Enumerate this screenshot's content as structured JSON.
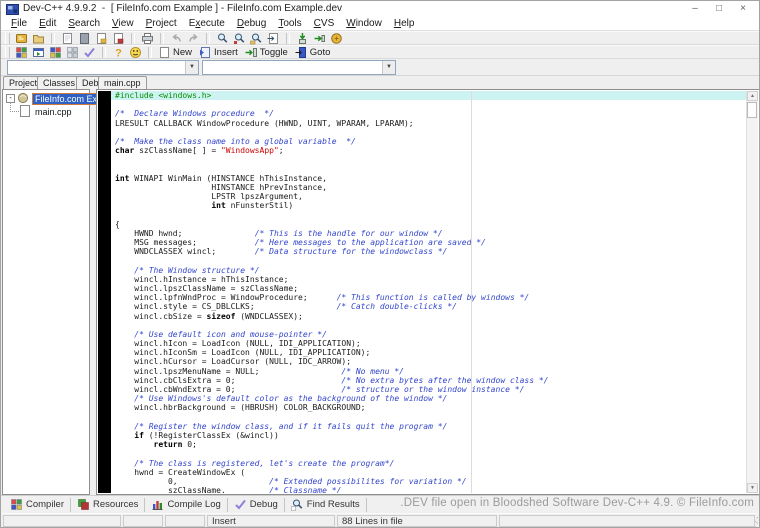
{
  "window": {
    "title": "Dev-C++ 4.9.9.2  -  [ FileInfo.com Example ] - FileInfo.com Example.dev",
    "controls": {
      "minimize": "–",
      "maximize": "□",
      "close": "×"
    }
  },
  "menu": {
    "items": [
      {
        "label": "File",
        "accel": 0
      },
      {
        "label": "Edit",
        "accel": 0
      },
      {
        "label": "Search",
        "accel": 0
      },
      {
        "label": "View",
        "accel": 0
      },
      {
        "label": "Project",
        "accel": 0
      },
      {
        "label": "Execute",
        "accel": 1
      },
      {
        "label": "Debug",
        "accel": 0
      },
      {
        "label": "Tools",
        "accel": 0
      },
      {
        "label": "CVS",
        "accel": 0
      },
      {
        "label": "Window",
        "accel": 0
      },
      {
        "label": "Help",
        "accel": 0
      }
    ]
  },
  "toolbar_row1": [
    {
      "name": "new-project"
    },
    {
      "name": "open-project"
    },
    {
      "sep": true
    },
    {
      "name": "save-file"
    },
    {
      "name": "save-all"
    },
    {
      "name": "close-file"
    },
    {
      "name": "close-all"
    },
    {
      "sep": true
    },
    {
      "name": "print"
    },
    {
      "sep": true
    },
    {
      "name": "undo"
    },
    {
      "name": "redo"
    },
    {
      "sep": true
    },
    {
      "name": "find"
    },
    {
      "name": "replace"
    },
    {
      "name": "find-in-files"
    },
    {
      "name": "goto-line"
    },
    {
      "sep": true
    },
    {
      "name": "add-to-project"
    },
    {
      "name": "remove-from-project"
    },
    {
      "name": "project-options"
    }
  ],
  "toolbar_row2": [
    {
      "name": "compile"
    },
    {
      "name": "run"
    },
    {
      "name": "compile-and-run"
    },
    {
      "name": "rebuild-all"
    },
    {
      "name": "debug"
    },
    {
      "sep": true
    },
    {
      "name": "help"
    },
    {
      "name": "about"
    },
    {
      "sep": true
    },
    {
      "name": "new-bookmark",
      "icon": "new-doc",
      "label": "New"
    },
    {
      "name": "insert-bookmark",
      "icon": "insert",
      "label": "Insert"
    },
    {
      "name": "toggle-bookmark",
      "icon": "toggle",
      "label": "Toggle"
    },
    {
      "name": "goto-bookmark",
      "icon": "goto",
      "label": "Goto"
    }
  ],
  "class_browser": {
    "classes_combo_value": "",
    "members_combo_value": "",
    "dropdown_glyph": "▼"
  },
  "left_pane": {
    "tabs": [
      "Project",
      "Classes",
      "Debug"
    ],
    "tree": {
      "collapse_glyph": "-",
      "root_label": "FileInfo.com Example",
      "child_label": "main.cpp"
    }
  },
  "editor": {
    "tab_label": "main.cpp",
    "caret_line_index": 0,
    "scroll": {
      "up_glyph": "▲",
      "down_glyph": "▼"
    },
    "code_lines": [
      "#include <windows.h>",
      "",
      "/*  Declare Windows procedure  */",
      "LRESULT CALLBACK WindowProcedure (HWND, UINT, WPARAM, LPARAM);",
      "",
      "/*  Make the class name into a global variable  */",
      "char szClassName[ ] = \"WindowsApp\";",
      "",
      "",
      "int WINAPI WinMain (HINSTANCE hThisInstance,",
      "                    HINSTANCE hPrevInstance,",
      "                    LPSTR lpszArgument,",
      "                    int nFunsterStil)",
      "",
      "{",
      "    HWND hwnd;               /* This is the handle for our window */",
      "    MSG messages;            /* Here messages to the application are saved */",
      "    WNDCLASSEX wincl;        /* Data structure for the windowclass */",
      "",
      "    /* The Window structure */",
      "    wincl.hInstance = hThisInstance;",
      "    wincl.lpszClassName = szClassName;",
      "    wincl.lpfnWndProc = WindowProcedure;      /* This function is called by windows */",
      "    wincl.style = CS_DBLCLKS;                 /* Catch double-clicks */",
      "    wincl.cbSize = sizeof (WNDCLASSEX);",
      "",
      "    /* Use default icon and mouse-pointer */",
      "    wincl.hIcon = LoadIcon (NULL, IDI_APPLICATION);",
      "    wincl.hIconSm = LoadIcon (NULL, IDI_APPLICATION);",
      "    wincl.hCursor = LoadCursor (NULL, IDC_ARROW);",
      "    wincl.lpszMenuName = NULL;                 /* No menu */",
      "    wincl.cbClsExtra = 0;                      /* No extra bytes after the window class */",
      "    wincl.cbWndExtra = 0;                      /* structure or the window instance */",
      "    /* Use Windows's default color as the background of the window */",
      "    wincl.hbrBackground = (HBRUSH) COLOR_BACKGROUND;",
      "",
      "    /* Register the window class, and if it fails quit the program */",
      "    if (!RegisterClassEx (&wincl))",
      "        return 0;",
      "",
      "    /* The class is registered, let's create the program*/",
      "    hwnd = CreateWindowEx (",
      "           0,                   /* Extended possibilites for variation */",
      "           szClassName,         /* Classname */"
    ],
    "syntax_colors": {
      "preprocessor": "#089000",
      "comment": "#3346cc",
      "string": "#cc0000",
      "keyword": "#000000",
      "caret_line_bg": "#ccf2f2"
    },
    "keywords": [
      "int",
      "char",
      "if",
      "return",
      "sizeof"
    ]
  },
  "bottom_panel": {
    "tabs": [
      {
        "label": "Compiler",
        "icon": "compiler"
      },
      {
        "label": "Resources",
        "icon": "resources"
      },
      {
        "label": "Compile Log",
        "icon": "compile-log"
      },
      {
        "label": "Debug",
        "icon": "debug-check"
      },
      {
        "label": "Find Results",
        "icon": "find-results"
      }
    ],
    "watermark": ".DEV file open in Bloodshed Software Dev-C++ 4.9. © FileInfo.com"
  },
  "statusbar": {
    "cells": [
      "",
      "",
      "",
      "Insert",
      "88 Lines in file",
      ""
    ]
  }
}
